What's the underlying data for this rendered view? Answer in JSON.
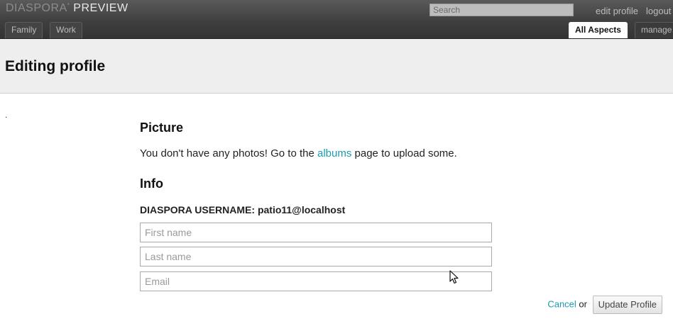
{
  "topbar": {
    "logo_part1": "DIASPORA",
    "logo_star": "*",
    "logo_part2": "PREVIEW",
    "search_placeholder": "Search",
    "links": {
      "edit_profile": "edit profile",
      "logout": "logout"
    },
    "aspect_tabs": [
      {
        "label": "Family"
      },
      {
        "label": "Work"
      }
    ],
    "all_aspects": "All Aspects",
    "manage": "manage"
  },
  "page": {
    "title": "Editing profile",
    "dot": "."
  },
  "picture": {
    "heading": "Picture",
    "text_before": "You don't have any photos! Go to the ",
    "link": "albums",
    "text_after": " page to upload some."
  },
  "info": {
    "heading": "Info",
    "username_label": "DIASPORA USERNAME: ",
    "username_value": "patio11@localhost",
    "first_name_placeholder": "First name",
    "last_name_placeholder": "Last name",
    "email_placeholder": "Email"
  },
  "actions": {
    "cancel": "Cancel",
    "or": "or",
    "update": "Update Profile"
  }
}
